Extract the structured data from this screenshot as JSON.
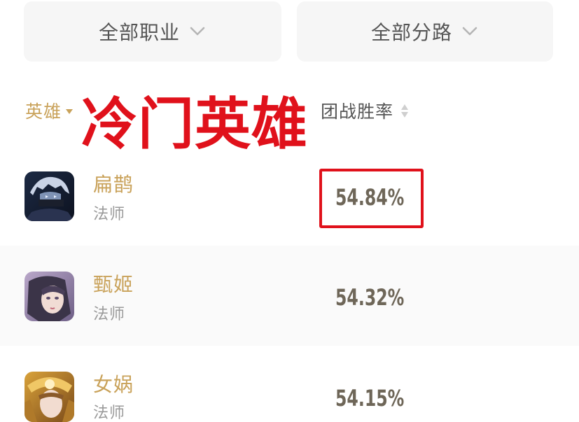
{
  "filters": {
    "role": {
      "label": "全部职业"
    },
    "lane": {
      "label": "全部分路"
    }
  },
  "table_header": {
    "hero_col": "英雄",
    "rate_col": "团战胜率"
  },
  "annotation": "冷门英雄",
  "heroes": [
    {
      "name": "扁鹊",
      "role": "法师",
      "win_rate": "54.84%",
      "highlighted": true
    },
    {
      "name": "甄姬",
      "role": "法师",
      "win_rate": "54.32%",
      "highlighted": false
    },
    {
      "name": "女娲",
      "role": "法师",
      "win_rate": "54.15%",
      "highlighted": false
    }
  ],
  "colors": {
    "accent_gold": "#c9a25a",
    "annotation_red": "#e0111b",
    "rate_text": "#6e6658",
    "filter_bg": "#f6f6f6"
  },
  "icons": [
    "chevron-down-icon",
    "sort-caret-down-icon",
    "sort-toggle-icon"
  ]
}
